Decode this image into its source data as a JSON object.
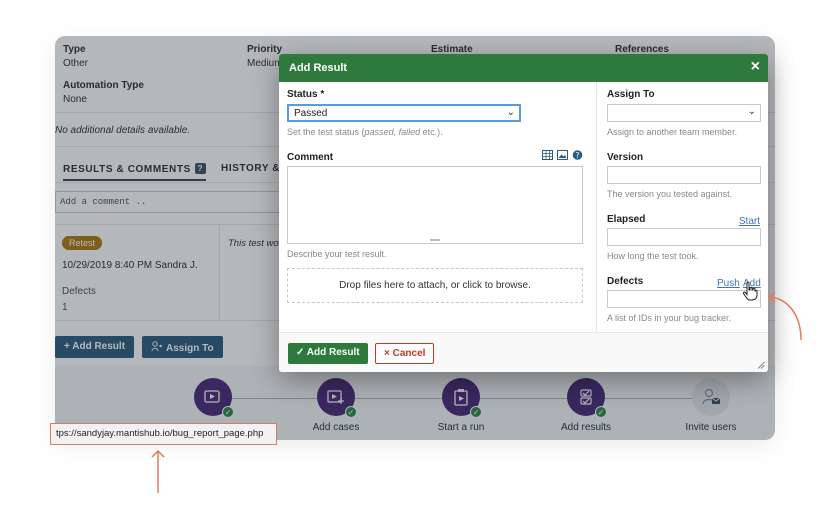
{
  "background": {
    "fields": [
      {
        "label": "Type",
        "value": "Other"
      },
      {
        "label": "Priority",
        "value": "Medium"
      },
      {
        "label": "Estimate",
        "value": ""
      },
      {
        "label": "References",
        "value": ""
      }
    ],
    "automation": {
      "label": "Automation Type",
      "value": "None"
    },
    "details_text": "No additional details available.",
    "tabs": {
      "results": "RESULTS & COMMENTS",
      "results_badge": "?",
      "history": "HISTORY & C"
    },
    "comment_placeholder": "Add a comment ..",
    "result": {
      "badge": "Retest",
      "badge_color": "#b07a14",
      "meta": "10/29/2019 8:40 PM Sandra J.",
      "defects_label": "Defects",
      "defects_value": "1",
      "text": "This test wo"
    },
    "buttons": {
      "add_result": "+ Add Result",
      "assign_to": "Assign To"
    },
    "steps": [
      {
        "label": "",
        "icon": "video-icon",
        "done": true,
        "active": true
      },
      {
        "label": "Add cases",
        "icon": "add-case-icon",
        "done": true,
        "active": true
      },
      {
        "label": "Start a run",
        "icon": "clipboard-play-icon",
        "done": true,
        "active": true
      },
      {
        "label": "Add results",
        "icon": "checklist-icon",
        "done": true,
        "active": true
      },
      {
        "label": "Invite users",
        "icon": "user-mail-icon",
        "done": false,
        "active": false
      }
    ]
  },
  "modal": {
    "title": "Add Result",
    "status": {
      "label": "Status *",
      "value": "Passed",
      "hint_prefix": "Set the test status (",
      "hint_em": "passed, failed",
      "hint_suffix": " etc.)."
    },
    "comment": {
      "label": "Comment",
      "hint": "Describe your test result."
    },
    "dropzone": "Drop files here to attach, or click to browse.",
    "assign_to": {
      "label": "Assign To",
      "value": "",
      "hint": "Assign to another team member."
    },
    "version": {
      "label": "Version",
      "hint": "The version you tested against."
    },
    "elapsed": {
      "label": "Elapsed",
      "link": "Start",
      "hint": "How long the test took."
    },
    "defects": {
      "label": "Defects",
      "push": "Push",
      "add": "Add",
      "hint": "A list of IDs in your bug tracker."
    },
    "ok_label": "Add Result",
    "cancel_label": "Cancel",
    "close_glyph": "×"
  },
  "status_bar_url": "tps://sandyjay.mantishub.io/bug_report_page.php",
  "colors": {
    "modal_header": "#2d7a3c",
    "accent_callout": "#e07b5a",
    "step_active": "#4a2b7a",
    "check_green": "#2e8a4a",
    "button_blue": "#2f5d80"
  }
}
